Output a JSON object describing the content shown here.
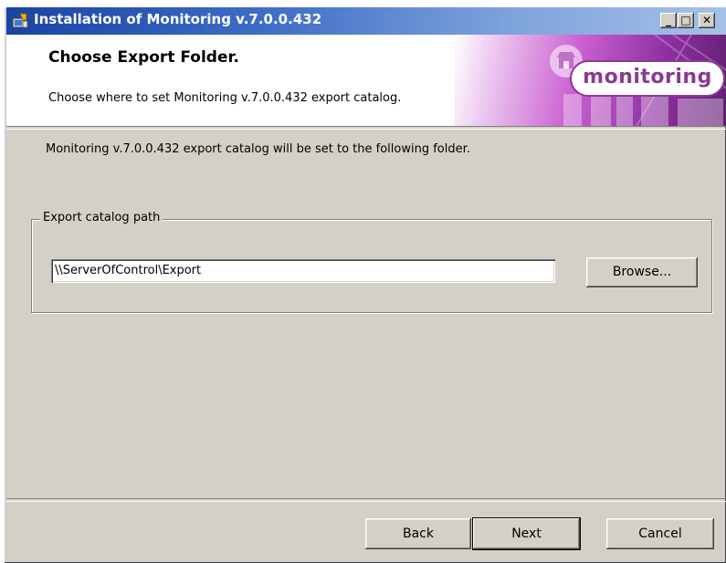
{
  "window": {
    "title": "Installation of Monitoring v.7.0.0.432",
    "minimize_glyph": "_",
    "maximize_glyph": "□",
    "close_glyph": "✕"
  },
  "banner": {
    "title": "Choose Export Folder.",
    "subtitle": "Choose where to set Monitoring v.7.0.0.432 export catalog.",
    "logo_text": "monitoring",
    "accent_color": "#8a3a93"
  },
  "main": {
    "description": "Monitoring v.7.0.0.432 export catalog will be set to the following folder.",
    "group_label": "Export catalog path",
    "path_value": "\\\\ServerOfControl\\Export",
    "browse_label": "Browse..."
  },
  "footer": {
    "back_label": "Back",
    "next_label": "Next",
    "cancel_label": "Cancel"
  },
  "icons": {
    "title_icon": "installer-icon",
    "banner_icon": "store-icon"
  }
}
